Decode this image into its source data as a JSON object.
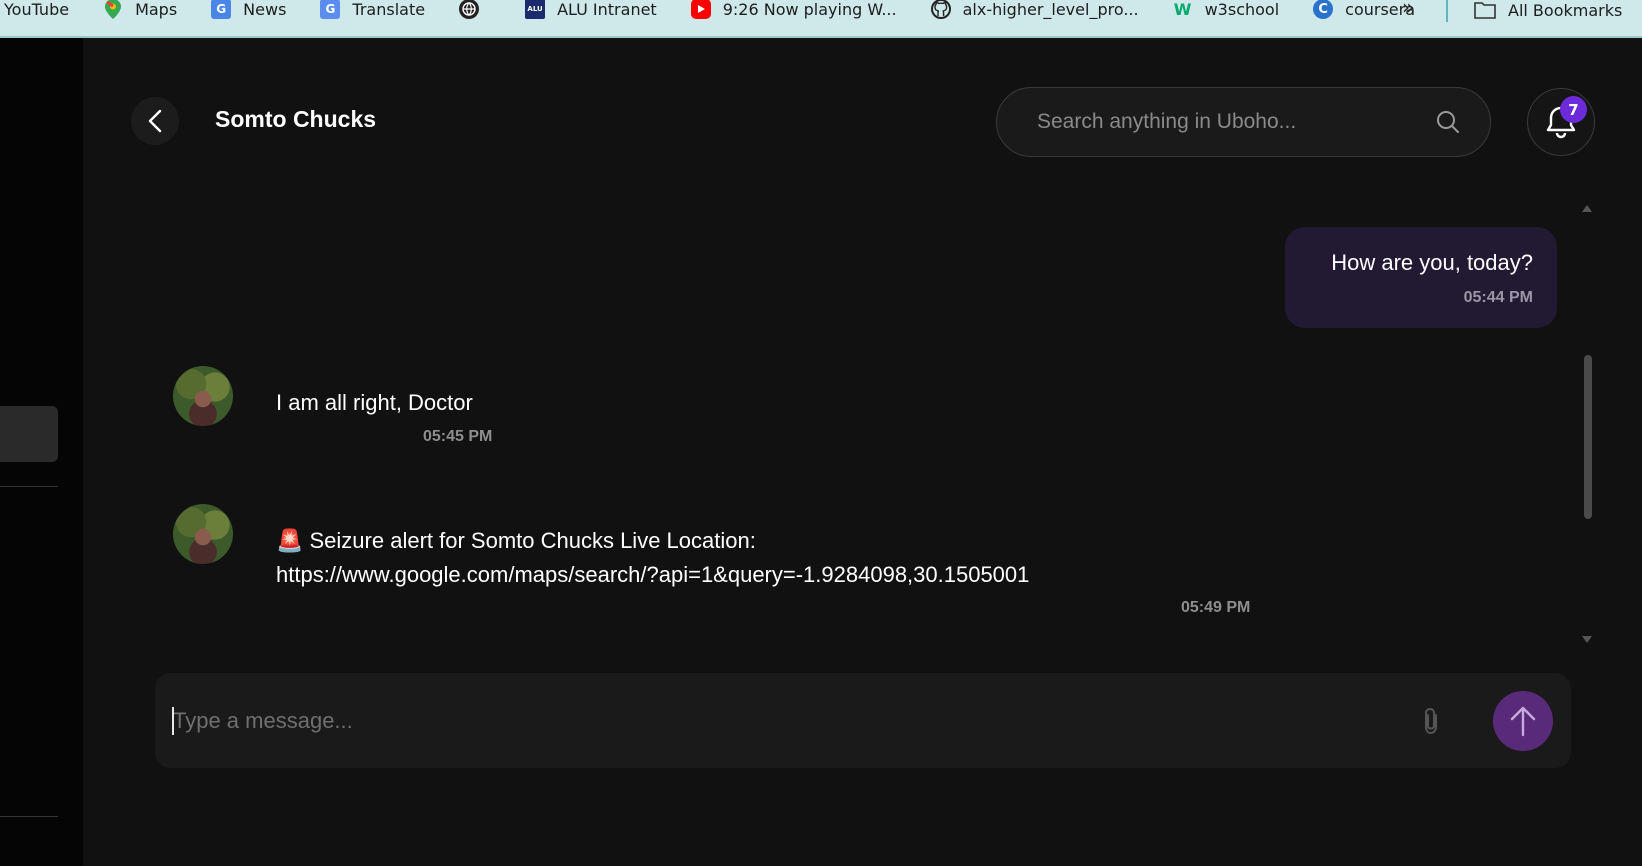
{
  "bookmarks": [
    {
      "label": "YouTube",
      "icon": "youtube-icon"
    },
    {
      "label": "Maps",
      "icon": "maps-icon"
    },
    {
      "label": "News",
      "icon": "news-icon"
    },
    {
      "label": "Translate",
      "icon": "translate-icon"
    },
    {
      "label": "",
      "icon": "globe-icon"
    },
    {
      "label": "ALU Intranet",
      "icon": "alu-icon"
    },
    {
      "label": "9:26 Now playing W...",
      "icon": "youtube-play-icon"
    },
    {
      "label": "alx-higher_level_pro...",
      "icon": "github-icon"
    },
    {
      "label": "w3school",
      "icon": "w3-icon"
    },
    {
      "label": "coursera",
      "icon": "coursera-icon"
    }
  ],
  "bookmarks_more": "»",
  "bookmarks_all": "All Bookmarks",
  "header": {
    "title": "Somto Chucks",
    "search_placeholder": "Search anything in Uboho...",
    "notification_count": "7"
  },
  "messages": {
    "outgoing": [
      {
        "text": "How are you, today?",
        "time": "05:44 PM"
      }
    ],
    "incoming": [
      {
        "text": "I am all right, Doctor",
        "time": "05:45 PM"
      },
      {
        "line1": "🚨 Seizure alert for Somto Chucks Live Location:",
        "line2": "https://www.google.com/maps/search/?api=1&query=-1.9284098,30.1505001",
        "time": "05:49 PM"
      }
    ]
  },
  "composer": {
    "placeholder": "Type a message..."
  },
  "colors": {
    "accent": "#6c2bd9",
    "send_button": "#5a2a7a",
    "outgoing_bubble": "#221a33",
    "background": "#111111"
  }
}
